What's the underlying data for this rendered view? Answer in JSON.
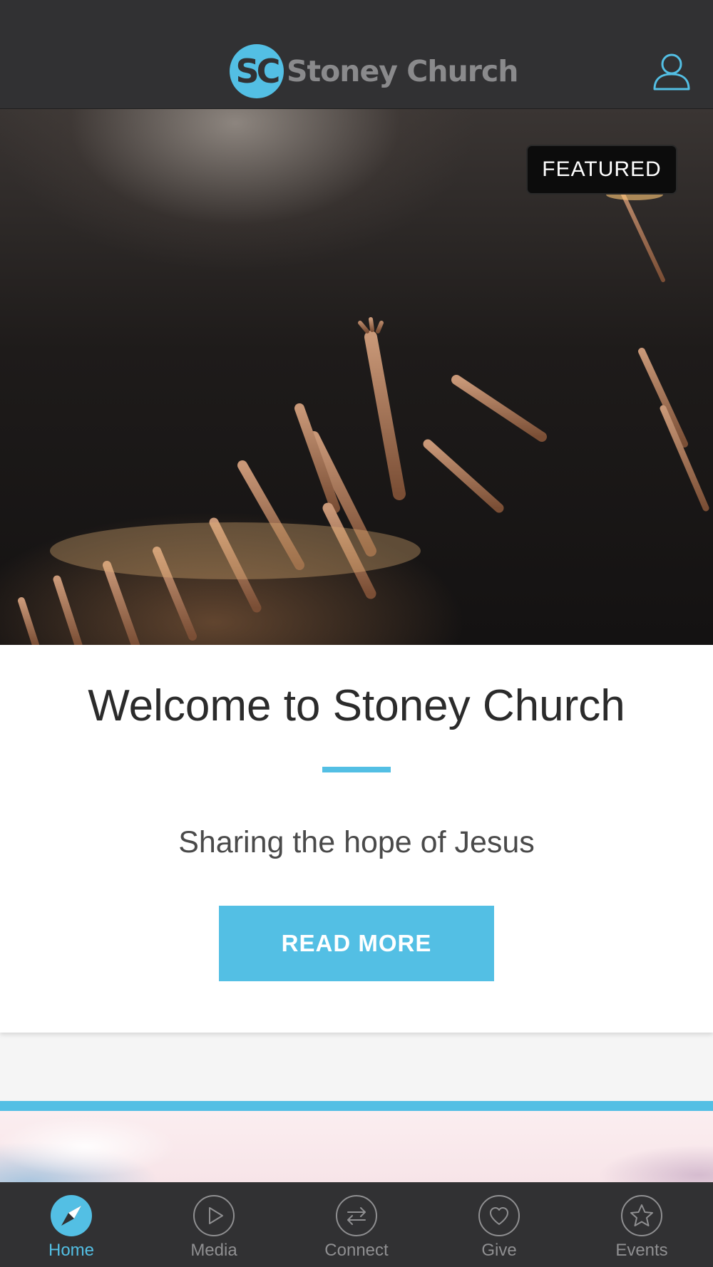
{
  "header": {
    "logo_badge": "SC",
    "logo_text": "Stoney Church",
    "user_icon": "user-icon"
  },
  "hero": {
    "badge": "FEATURED"
  },
  "card": {
    "title": "Welcome to Stoney Church",
    "subtitle": "Sharing the hope of Jesus",
    "button_label": "READ MORE"
  },
  "tabs": [
    {
      "label": "Home",
      "icon": "compass-icon",
      "active": true
    },
    {
      "label": "Media",
      "icon": "play-icon",
      "active": false
    },
    {
      "label": "Connect",
      "icon": "exchange-icon",
      "active": false
    },
    {
      "label": "Give",
      "icon": "heart-icon",
      "active": false
    },
    {
      "label": "Events",
      "icon": "star-icon",
      "active": false
    }
  ],
  "colors": {
    "accent": "#53bfe4",
    "header_bg": "#313133",
    "tab_inactive": "#8f8f91"
  }
}
